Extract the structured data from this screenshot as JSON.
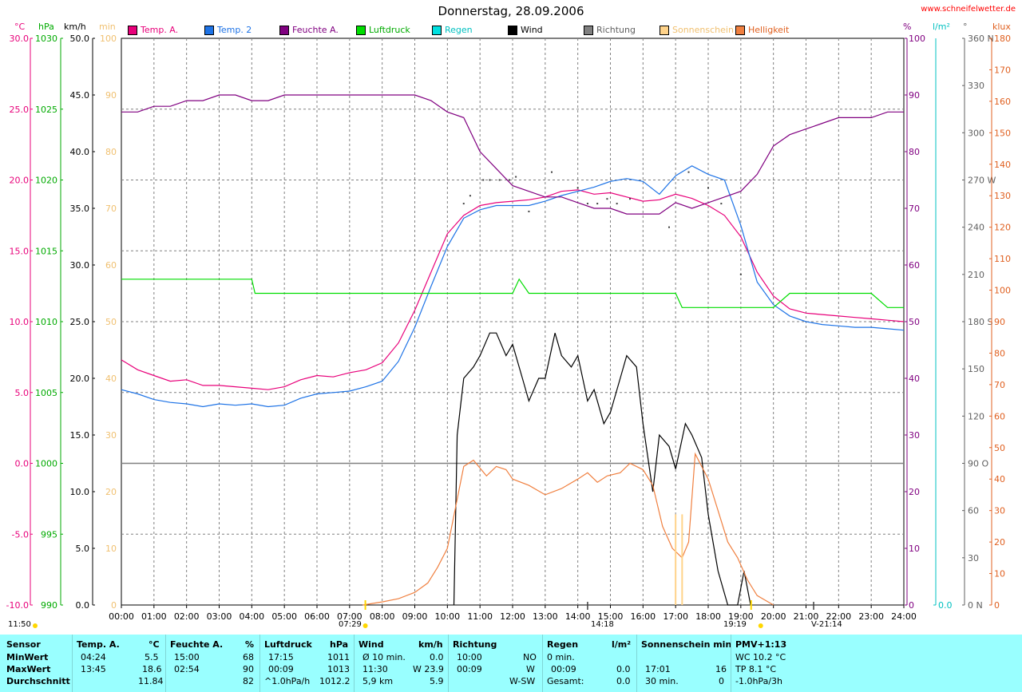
{
  "title": "Donnerstag, 28.09.2006",
  "site": "www.schneifelwetter.de",
  "colors": {
    "temp_a": "#e8007a",
    "temp2": "#1e73e6",
    "feuchte": "#800080",
    "luftdruck": "#00dd00",
    "regen": "#00e0e0",
    "wind": "#000000",
    "richtung": "#808080",
    "sonnenschein": "#ffd38a",
    "helligkeit": "#f08040"
  },
  "legend": [
    {
      "label": "Temp. A.",
      "color": "#e8007a"
    },
    {
      "label": "Temp. 2",
      "color": "#1e73e6"
    },
    {
      "label": "Feuchte A.",
      "color": "#800080"
    },
    {
      "label": "Luftdruck",
      "color": "#00dd00"
    },
    {
      "label": "Regen",
      "color": "#00e0e0"
    },
    {
      "label": "Wind",
      "color": "#000000"
    },
    {
      "label": "Richtung",
      "color": "#808080"
    },
    {
      "label": "Sonnenschein",
      "color": "#ffd38a"
    },
    {
      "label": "Helligkeit",
      "color": "#f08040"
    }
  ],
  "units": {
    "celsius": "°C",
    "hpa": "hPa",
    "kmh": "km/h",
    "min": "min",
    "percent": "%",
    "lm2": "l/m²",
    "degree": "°",
    "klux": "klux"
  },
  "sun_events": {
    "sunrise": "07:29",
    "sunset": "19:19",
    "moon1": "14:18",
    "moon2": "21:14",
    "moon2_prefix": "V"
  },
  "chart_data": {
    "type": "line",
    "title": "Donnerstag, 28.09.2006",
    "x_ticks": [
      "00:00",
      "01:00",
      "02:00",
      "03:00",
      "04:00",
      "05:00",
      "06:00",
      "07:00",
      "08:00",
      "09:00",
      "10:00",
      "11:00",
      "12:00",
      "13:00",
      "14:00",
      "15:00",
      "16:00",
      "17:00",
      "18:00",
      "19:00",
      "20:00",
      "21:00",
      "22:00",
      "23:00",
      "24:00"
    ],
    "axes": {
      "celsius": {
        "range": [
          -10,
          30
        ],
        "ticks": [
          "30.0",
          "25.0",
          "20.0",
          "15.0",
          "10.0",
          "5.0",
          "0.0",
          "-5.0",
          "-10.0"
        ]
      },
      "hpa": {
        "range": [
          990,
          1030
        ],
        "ticks": [
          "1030",
          "1025",
          "1020",
          "1015",
          "1010",
          "1005",
          "1000",
          "995",
          "990"
        ]
      },
      "kmh": {
        "range": [
          0,
          50
        ],
        "ticks": [
          "50.0",
          "45.0",
          "40.0",
          "35.0",
          "30.0",
          "25.0",
          "20.0",
          "15.0",
          "10.0",
          "5.0",
          "0.0"
        ]
      },
      "min": {
        "range": [
          0,
          100
        ],
        "ticks": [
          "100",
          "90",
          "80",
          "70",
          "60",
          "50",
          "40",
          "30",
          "20",
          "10",
          "0"
        ]
      },
      "percent": {
        "range": [
          0,
          100
        ],
        "ticks": [
          "100",
          "90",
          "80",
          "70",
          "60",
          "50",
          "40",
          "30",
          "20",
          "10",
          "0"
        ]
      },
      "lm2": {
        "range": [
          0,
          1
        ],
        "ticks": [
          "0.0"
        ]
      },
      "degree": {
        "range": [
          0,
          360
        ],
        "ticks": [
          "360 N",
          "330",
          "300",
          "270 W",
          "240",
          "210",
          "180 S",
          "150",
          "120",
          "90 O",
          "60",
          "30",
          "0 N"
        ]
      },
      "klux": {
        "range": [
          0,
          180
        ],
        "ticks": [
          "180",
          "170",
          "160",
          "150",
          "140",
          "130",
          "120",
          "110",
          "100",
          "90",
          "80",
          "70",
          "60",
          "50",
          "40",
          "30",
          "20",
          "10",
          "0"
        ]
      }
    },
    "series": [
      {
        "name": "Temp. A.",
        "axis": "celsius",
        "x": [
          0,
          0.5,
          1,
          1.5,
          2,
          2.5,
          3,
          3.5,
          4,
          4.5,
          5,
          5.5,
          6,
          6.5,
          7,
          7.5,
          8,
          8.5,
          9,
          9.5,
          10,
          10.5,
          11,
          11.5,
          12,
          12.5,
          13,
          13.5,
          14,
          14.5,
          15,
          15.5,
          16,
          16.5,
          17,
          17.5,
          18,
          18.5,
          19,
          19.5,
          20,
          20.5,
          21,
          21.5,
          22,
          22.5,
          23,
          23.5,
          24
        ],
        "y": [
          7.3,
          6.6,
          6.2,
          5.8,
          5.9,
          5.5,
          5.5,
          5.4,
          5.3,
          5.2,
          5.4,
          5.9,
          6.2,
          6.1,
          6.4,
          6.6,
          7.1,
          8.5,
          10.8,
          13.5,
          16.2,
          17.5,
          18.2,
          18.4,
          18.5,
          18.6,
          18.8,
          19.2,
          19.3,
          19.0,
          19.1,
          18.8,
          18.5,
          18.6,
          19.0,
          18.7,
          18.2,
          17.5,
          16.0,
          13.5,
          11.8,
          10.9,
          10.6,
          10.5,
          10.4,
          10.3,
          10.2,
          10.1,
          10.0
        ]
      },
      {
        "name": "Temp. 2",
        "axis": "celsius",
        "x": [
          0,
          0.5,
          1,
          1.5,
          2,
          2.5,
          3,
          3.5,
          4,
          4.5,
          5,
          5.5,
          6,
          6.5,
          7,
          7.5,
          8,
          8.5,
          9,
          9.5,
          10,
          10.5,
          11,
          11.5,
          12,
          12.5,
          13,
          13.5,
          14,
          14.5,
          15,
          15.5,
          16,
          16.5,
          17,
          17.5,
          18,
          18.5,
          19,
          19.5,
          20,
          20.5,
          21,
          21.5,
          22,
          22.5,
          23,
          23.5,
          24
        ],
        "y": [
          5.2,
          4.9,
          4.5,
          4.3,
          4.2,
          4.0,
          4.2,
          4.1,
          4.2,
          4.0,
          4.1,
          4.6,
          4.9,
          5.0,
          5.1,
          5.4,
          5.8,
          7.2,
          9.6,
          12.5,
          15.3,
          17.3,
          17.9,
          18.2,
          18.2,
          18.2,
          18.5,
          18.9,
          19.2,
          19.5,
          19.9,
          20.1,
          19.9,
          19.0,
          20.3,
          21.0,
          20.4,
          20.0,
          16.8,
          12.8,
          11.2,
          10.4,
          10.0,
          9.8,
          9.7,
          9.6,
          9.6,
          9.5,
          9.4
        ]
      },
      {
        "name": "Feuchte A.",
        "axis": "percent",
        "x": [
          0,
          0.5,
          1,
          1.5,
          2,
          2.5,
          3,
          3.5,
          4,
          4.5,
          5,
          5.5,
          6,
          6.5,
          7,
          7.5,
          8,
          8.5,
          9,
          9.5,
          10,
          10.5,
          11,
          11.5,
          12,
          12.5,
          13,
          13.5,
          14,
          14.5,
          15,
          15.5,
          16,
          16.5,
          17,
          17.5,
          18,
          18.5,
          19,
          19.5,
          20,
          20.5,
          21,
          21.5,
          22,
          22.5,
          23,
          23.5,
          24
        ],
        "y": [
          87,
          87,
          88,
          88,
          89,
          89,
          90,
          90,
          89,
          89,
          90,
          90,
          90,
          90,
          90,
          90,
          90,
          90,
          90,
          89,
          87,
          86,
          80,
          77,
          74,
          73,
          72,
          72,
          71,
          70,
          70,
          69,
          69,
          69,
          71,
          70,
          71,
          72,
          73,
          76,
          81,
          83,
          84,
          85,
          86,
          86,
          86,
          87,
          87
        ]
      },
      {
        "name": "Luftdruck",
        "axis": "hpa",
        "x": [
          0,
          1,
          2,
          3,
          4,
          4.1,
          5,
          6,
          7,
          8,
          9,
          10,
          11,
          12,
          12.2,
          12.5,
          13,
          14,
          15,
          16,
          17,
          17.2,
          18,
          19,
          20,
          20.5,
          21,
          22,
          23,
          23.5,
          24
        ],
        "y": [
          1013,
          1013,
          1013,
          1013,
          1013,
          1012,
          1012,
          1012,
          1012,
          1012,
          1012,
          1012,
          1012,
          1012,
          1013,
          1012,
          1012,
          1012,
          1012,
          1012,
          1012,
          1011,
          1011,
          1011,
          1011,
          1012,
          1012,
          1012,
          1012,
          1011,
          1011
        ]
      },
      {
        "name": "Wind",
        "axis": "kmh",
        "x": [
          10.2,
          10.3,
          10.5,
          10.8,
          11,
          11.3,
          11.5,
          11.8,
          12,
          12.3,
          12.5,
          12.8,
          13,
          13.3,
          13.5,
          13.8,
          14,
          14.3,
          14.5,
          14.8,
          15,
          15.3,
          15.5,
          15.8,
          16,
          16.3,
          16.5,
          16.8,
          17,
          17.3,
          17.5,
          17.8,
          18,
          18.3,
          18.6,
          18.9,
          19.1,
          19.3
        ],
        "y": [
          0,
          15,
          20,
          21,
          22,
          24,
          24,
          22,
          23,
          20,
          18,
          20,
          20,
          24,
          22,
          21,
          22,
          18,
          19,
          16,
          17,
          20,
          22,
          21,
          16,
          10,
          15,
          14,
          12,
          16,
          15,
          13,
          8,
          3,
          0,
          0,
          3,
          0
        ]
      },
      {
        "name": "Helligkeit",
        "axis": "klux",
        "x": [
          7.4,
          8,
          8.5,
          9,
          9.4,
          9.7,
          10,
          10.5,
          10.8,
          11.2,
          11.5,
          11.8,
          12,
          12.5,
          13,
          13.5,
          14,
          14.3,
          14.6,
          14.9,
          15.3,
          15.6,
          16,
          16.3,
          16.6,
          16.9,
          17.2,
          17.4,
          17.6,
          17.8,
          18,
          18.3,
          18.6,
          18.9,
          19.2,
          19.5,
          20
        ],
        "y": [
          0,
          1,
          2,
          4,
          7,
          12,
          18,
          44,
          46,
          41,
          44,
          43,
          40,
          38,
          35,
          37,
          40,
          42,
          39,
          41,
          42,
          45,
          43,
          38,
          25,
          18,
          15,
          20,
          48,
          44,
          40,
          30,
          20,
          15,
          8,
          3,
          0
        ]
      },
      {
        "name": "Sonnenschein",
        "axis": "min",
        "x": [
          17.0,
          17.1,
          17.2,
          17.3
        ],
        "y": [
          16,
          0,
          16,
          0
        ]
      }
    ],
    "richtung_points": {
      "axis": "degree",
      "x": [
        10.5,
        10.7,
        11.1,
        11.3,
        11.6,
        11.9,
        12.1,
        12.5,
        13.2,
        14.0,
        14.3,
        14.6,
        14.9,
        15.2,
        15.6,
        16.8,
        17.4,
        18.0,
        18.4,
        19.0
      ],
      "y": [
        255,
        260,
        270,
        270,
        270,
        270,
        272,
        250,
        275,
        265,
        255,
        255,
        258,
        255,
        258,
        240,
        275,
        265,
        255,
        210
      ]
    },
    "grid": "dashed",
    "zero_line": 0
  },
  "table": {
    "rows": [
      "Sensor",
      "MinWert",
      "MaxWert",
      "Durchschnitt"
    ],
    "temp": {
      "hdr": "Temp. A.",
      "unit": "°C",
      "min_t": "04:24",
      "min_v": "5.5",
      "max_t": "13:45",
      "max_v": "18.6",
      "avg": "11.84"
    },
    "feuchte": {
      "hdr": "Feuchte A.",
      "unit": "%",
      "min_t": "15:00",
      "min_v": "68",
      "max_t": "02:54",
      "max_v": "90",
      "avg": "82"
    },
    "luftdruck": {
      "hdr": "Luftdruck",
      "unit": "hPa",
      "min_t": "17:15",
      "min_v": "1011",
      "max_t": "00:09",
      "max_v": "1013",
      "avg_t": "^1.0hPa/h",
      "avg": "1012.2"
    },
    "wind": {
      "hdr": "Wind",
      "unit": "km/h",
      "min_t": "Ø 10 min.",
      "min_v": "0.0",
      "max_t": "11:30",
      "max_v": "W 23.9",
      "avg_t": "5,9 km",
      "avg": "5.9"
    },
    "richtung": {
      "hdr": "Richtung",
      "min_t": "10:00",
      "min_v": "NO",
      "max_t": "00:09",
      "max_v": "W",
      "avg": "W-SW"
    },
    "regen": {
      "hdr": "Regen",
      "unit": "l/m²",
      "min_t": "0 min.",
      "max_t": "00:09",
      "max_v": "0.0",
      "avg_t": "Gesamt:",
      "avg": "0.0"
    },
    "sonne": {
      "hdr": "Sonnenschein min",
      "max_t": "17:01",
      "max_v": "16",
      "avg_t": "30 min.",
      "avg": "0"
    },
    "pmv": {
      "hdr": "PMV+1:13",
      "r1": "WC 10.2 °C",
      "r2": "TP 8.1 °C",
      "r3": "-1.0hPa/3h"
    }
  },
  "clock": "11:50"
}
